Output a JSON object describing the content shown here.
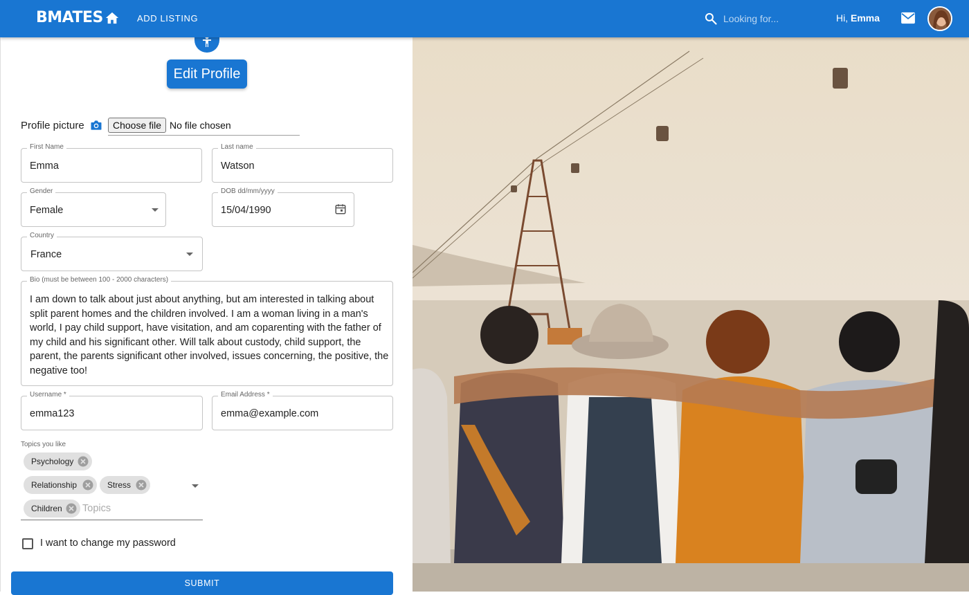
{
  "app": {
    "logo_text": "MATES",
    "add_listing": "ADD LISTING",
    "search_placeholder": "Looking for...",
    "greeting_prefix": "Hi,",
    "user_name": "Emma",
    "brand_color": "#1976d2"
  },
  "form": {
    "title": "Edit Profile",
    "profile_picture_label": "Profile picture",
    "choose_file_label": "Choose file",
    "file_status": "No file chosen",
    "first_name": {
      "label": "First Name",
      "value": "Emma"
    },
    "last_name": {
      "label": "Last name",
      "value": "Watson"
    },
    "gender": {
      "label": "Gender",
      "value": "Female"
    },
    "dob": {
      "label": "DOB dd/mm/yyyy",
      "value": "15/04/1990"
    },
    "country": {
      "label": "Country",
      "value": "France"
    },
    "bio": {
      "label": "Bio (must be between 100 - 2000 characters)",
      "value": "I am down to talk about just about anything, but am interested in talking about split parent homes and the children involved.  I am a woman living in a man's world, I pay child support, have visitation, and am coparenting with the father of my child and his significant other. Will talk about custody, child support, the parent, the parents significant other involved, issues concerning, the positive, the negative too!"
    },
    "username": {
      "label": "Username *",
      "value": "emma123"
    },
    "email": {
      "label": "Email Address *",
      "value": "emma@example.com"
    },
    "topics": {
      "label": "Topics you like",
      "chips": [
        "Psychology",
        "Relationship",
        "Stress",
        "Children"
      ],
      "placeholder": "Topics"
    },
    "change_password_label": "I want to change my password",
    "submit_label": "SUBMIT"
  },
  "icons": [
    "home-icon",
    "search-icon",
    "mail-icon",
    "avatar",
    "profile-icon",
    "camera-icon",
    "chevron-down-icon",
    "calendar-icon",
    "chip-delete-icon",
    "checkbox-icon"
  ]
}
